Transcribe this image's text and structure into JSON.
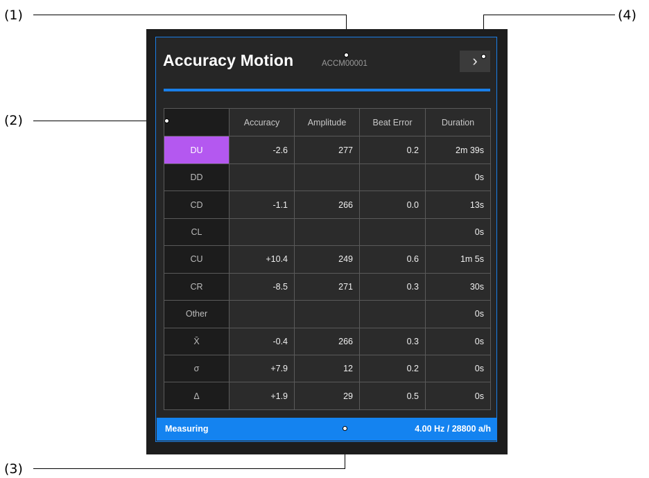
{
  "callouts": [
    "(1)",
    "(2)",
    "(3)",
    "(4)"
  ],
  "header": {
    "title": "Accuracy Motion",
    "serial": "ACCM00001",
    "next_icon": "chevron-right",
    "next_glyph": "›"
  },
  "table": {
    "columns": [
      "Accuracy",
      "Amplitude",
      "Beat Error",
      "Duration"
    ],
    "rows": [
      {
        "label": "DU",
        "accuracy": "-2.6",
        "amplitude": "277",
        "beat_error": "0.2",
        "duration": "2m 39s",
        "active": true
      },
      {
        "label": "DD",
        "accuracy": "",
        "amplitude": "",
        "beat_error": "",
        "duration": "0s"
      },
      {
        "label": "CD",
        "accuracy": "-1.1",
        "amplitude": "266",
        "beat_error": "0.0",
        "duration": "13s"
      },
      {
        "label": "CL",
        "accuracy": "",
        "amplitude": "",
        "beat_error": "",
        "duration": "0s"
      },
      {
        "label": "CU",
        "accuracy": "+10.4",
        "amplitude": "249",
        "beat_error": "0.6",
        "duration": "1m 5s"
      },
      {
        "label": "CR",
        "accuracy": "-8.5",
        "amplitude": "271",
        "beat_error": "0.3",
        "duration": "30s"
      },
      {
        "label": "Other",
        "accuracy": "",
        "amplitude": "",
        "beat_error": "",
        "duration": "0s"
      },
      {
        "label": "X̄",
        "accuracy": "-0.4",
        "amplitude": "266",
        "beat_error": "0.3",
        "duration": "0s"
      },
      {
        "label": "σ",
        "accuracy": "+7.9",
        "amplitude": "12",
        "beat_error": "0.2",
        "duration": "0s"
      },
      {
        "label": "Δ",
        "accuracy": "+1.9",
        "amplitude": "29",
        "beat_error": "0.5",
        "duration": "0s"
      }
    ]
  },
  "status": {
    "state": "Measuring",
    "frequency": "4.00 Hz / 28800 a/h"
  },
  "colors": {
    "accent": "#1a7fe8",
    "status_bar": "#1483f0",
    "active_position": "#b458f0",
    "panel_bg": "#1d1d1d"
  }
}
